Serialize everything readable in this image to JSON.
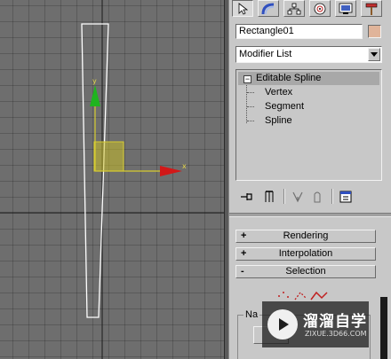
{
  "viewport": {
    "axis_y_label": "y",
    "axis_x_label": "x"
  },
  "command_panel": {
    "tabs": [
      {
        "icon": "create-arrow-icon",
        "active": true
      },
      {
        "icon": "modify-arc-icon"
      },
      {
        "icon": "hierarchy-icon"
      },
      {
        "icon": "motion-icon"
      },
      {
        "icon": "display-icon"
      },
      {
        "icon": "utilities-hammer-icon"
      }
    ],
    "object_name": "Rectangle01",
    "object_color": "#e0b49a",
    "modifier_list": "Modifier List",
    "stack": {
      "root": "Editable Spline",
      "root_expander": "−",
      "children": [
        "Vertex",
        "Segment",
        "Spline"
      ]
    },
    "toolbar_icons": [
      "pin-stack-icon",
      "show-end-result-icon",
      "make-unique-icon",
      "remove-modifier-icon",
      "configure-modifier-sets-icon"
    ],
    "rollouts": [
      {
        "sign": "+",
        "label": "Rendering"
      },
      {
        "sign": "+",
        "label": "Interpolation"
      },
      {
        "sign": "-",
        "label": "Selection"
      }
    ],
    "named_selections_label": "Na"
  },
  "watermark": {
    "title": "溜溜自学",
    "subtitle": "ZIXUE.3D66.COM"
  }
}
